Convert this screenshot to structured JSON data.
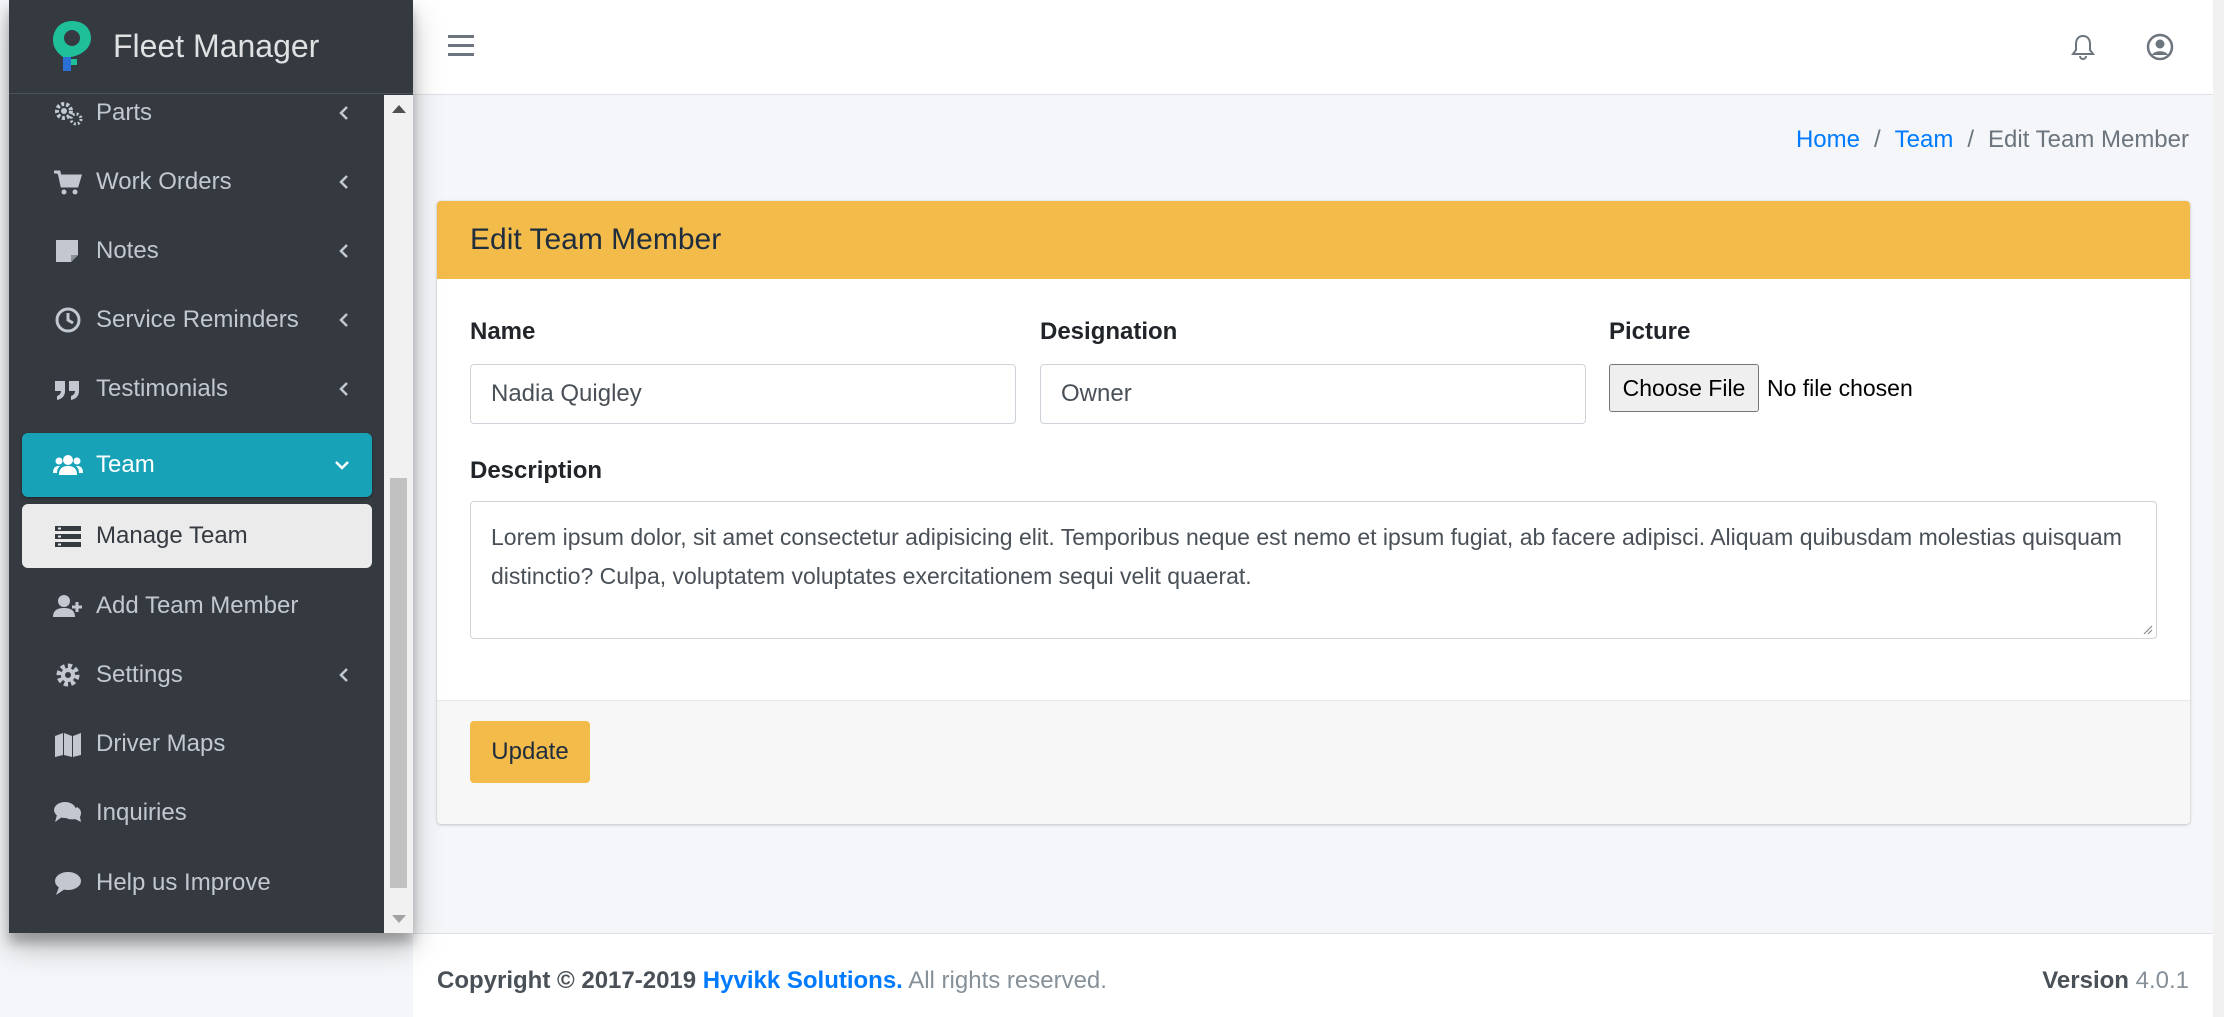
{
  "app": {
    "brand": "Fleet Manager"
  },
  "sidebar": {
    "items": [
      {
        "label": "Parts",
        "icon": "gears-icon",
        "has_chevron": true
      },
      {
        "label": "Work Orders",
        "icon": "cart-icon",
        "has_chevron": true
      },
      {
        "label": "Notes",
        "icon": "sticky-note-icon",
        "has_chevron": true
      },
      {
        "label": "Service Reminders",
        "icon": "clock-icon",
        "has_chevron": true
      },
      {
        "label": "Testimonials",
        "icon": "quote-icon",
        "has_chevron": true
      },
      {
        "label": "Team",
        "icon": "users-icon",
        "has_chevron": true,
        "active": true
      },
      {
        "label": "Manage Team",
        "icon": "list-icon",
        "sub_active": true
      },
      {
        "label": "Add Team Member",
        "icon": "user-plus-icon"
      },
      {
        "label": "Settings",
        "icon": "gear-icon",
        "has_chevron": true
      },
      {
        "label": "Driver Maps",
        "icon": "map-icon"
      },
      {
        "label": "Inquiries",
        "icon": "comments-icon"
      },
      {
        "label": "Help us Improve",
        "icon": "comment-icon"
      }
    ]
  },
  "topbar": {
    "menu_icon": "hamburger-icon",
    "bell_icon": "bell-icon",
    "user_icon": "user-circle-icon"
  },
  "breadcrumb": {
    "home": "Home",
    "team": "Team",
    "current": "Edit Team Member",
    "separator": "/"
  },
  "card": {
    "title": "Edit Team Member",
    "name_label": "Name",
    "name_value": "Nadia Quigley",
    "designation_label": "Designation",
    "designation_value": "Owner",
    "picture_label": "Picture",
    "choose_file": "Choose File",
    "file_status": "No file chosen",
    "description_label": "Description",
    "description_value": "Lorem ipsum dolor, sit amet consectetur adipisicing elit. Temporibus neque est nemo et ipsum fugiat, ab facere adipisci. Aliquam quibusdam molestias quisquam distinctio? Culpa, voluptatem voluptates exercitationem sequi velit quaerat.",
    "update_button": "Update"
  },
  "footer": {
    "copyright_prefix": "Copyright © 2017-2019",
    "company": "Hyvikk Solutions.",
    "rights": "All rights reserved.",
    "version_label": "Version",
    "version_value": "4.0.1"
  },
  "colors": {
    "accent": "#f3bb4a",
    "active": "#17a2b8",
    "sidebar": "#343a40",
    "link": "#007bff"
  }
}
